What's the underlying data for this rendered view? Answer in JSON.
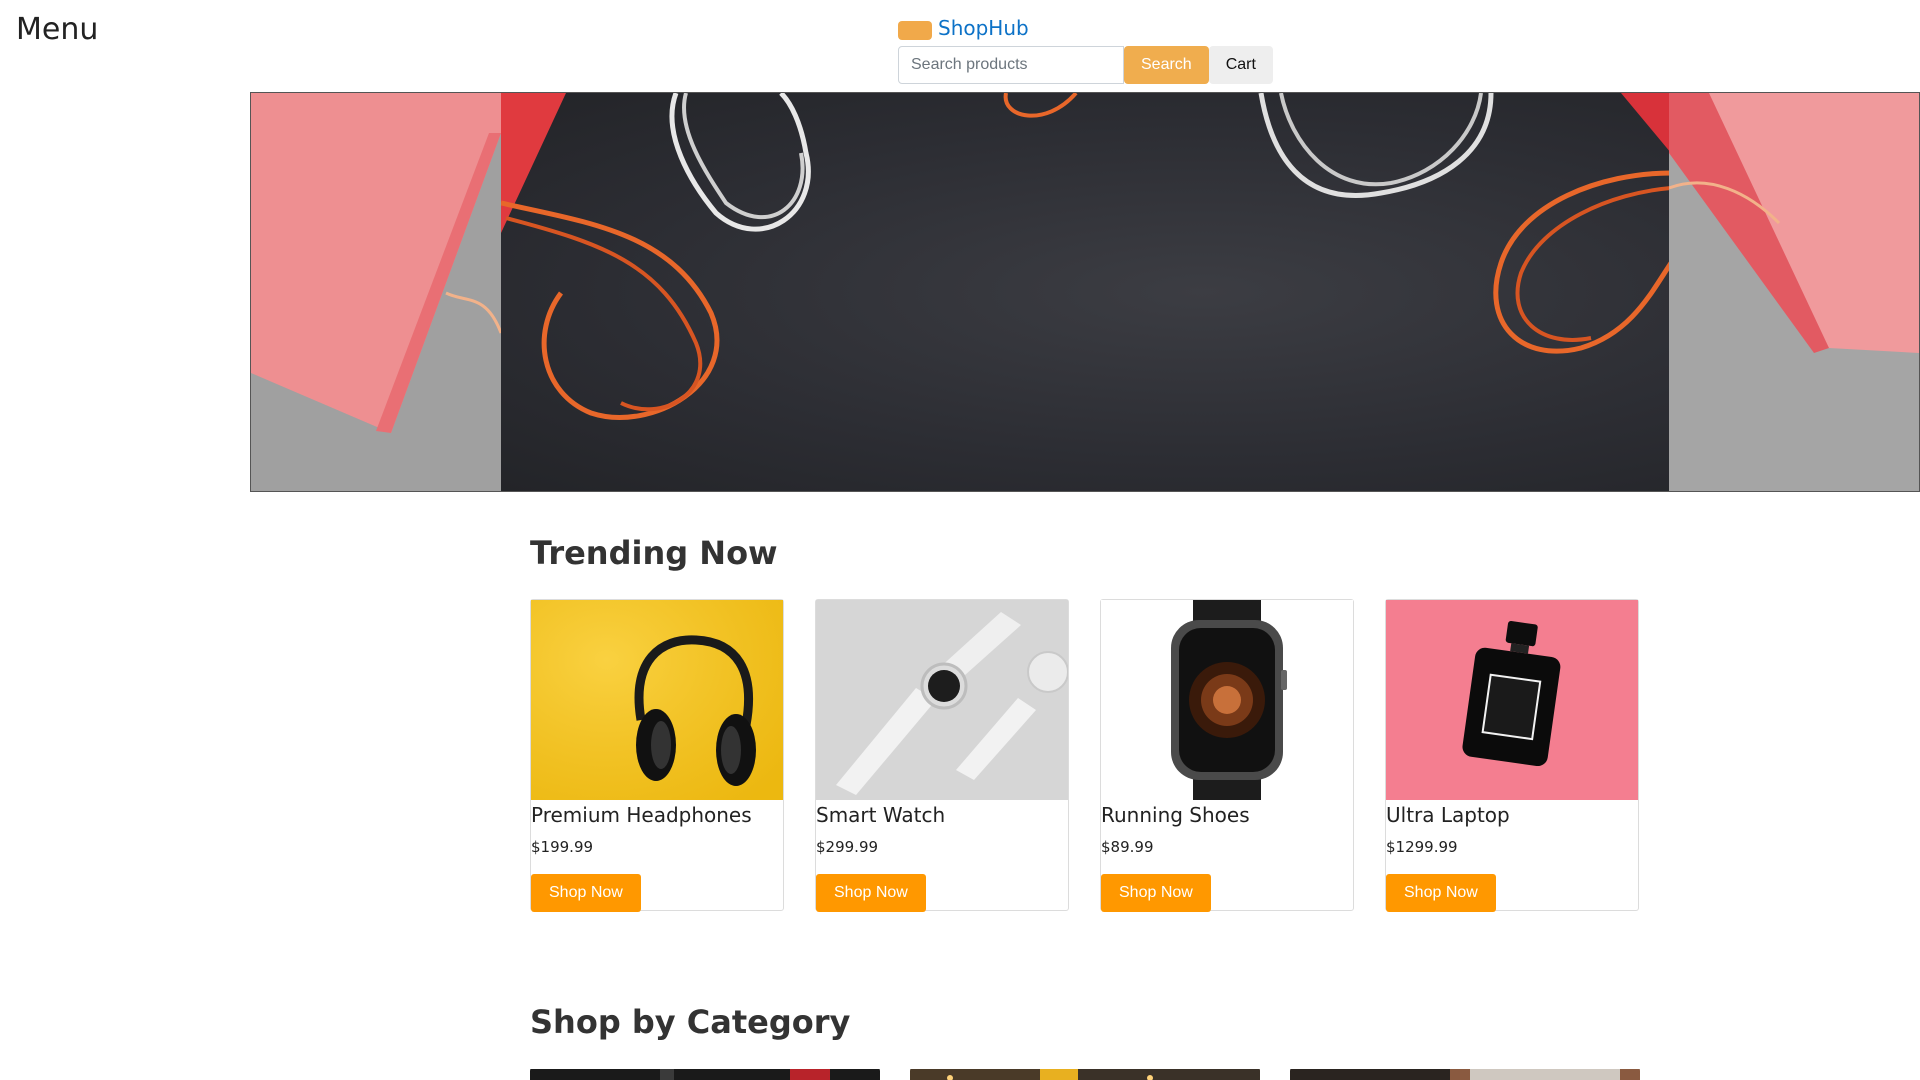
{
  "header": {
    "menu_label": "Menu",
    "brand_name": "ShopHub",
    "search": {
      "placeholder": "Search products",
      "value": ""
    },
    "search_button": "Search",
    "cart_button": "Cart"
  },
  "colors": {
    "brand_link": "#0d72c7",
    "search_button": "#f0ad4e",
    "shop_button": "#ff9800"
  },
  "trending": {
    "title": "Trending Now",
    "products": [
      {
        "name": "Premium Headphones",
        "price": "$199.99",
        "button": "Shop Now",
        "image": "headphones-image"
      },
      {
        "name": "Smart Watch",
        "price": "$299.99",
        "button": "Shop Now",
        "image": "watch-image"
      },
      {
        "name": "Running Shoes",
        "price": "$89.99",
        "button": "Shop Now",
        "image": "smartwatch-image"
      },
      {
        "name": "Ultra Laptop",
        "price": "$1299.99",
        "button": "Shop Now",
        "image": "perfume-image"
      }
    ]
  },
  "categories": {
    "title": "Shop by Category"
  }
}
